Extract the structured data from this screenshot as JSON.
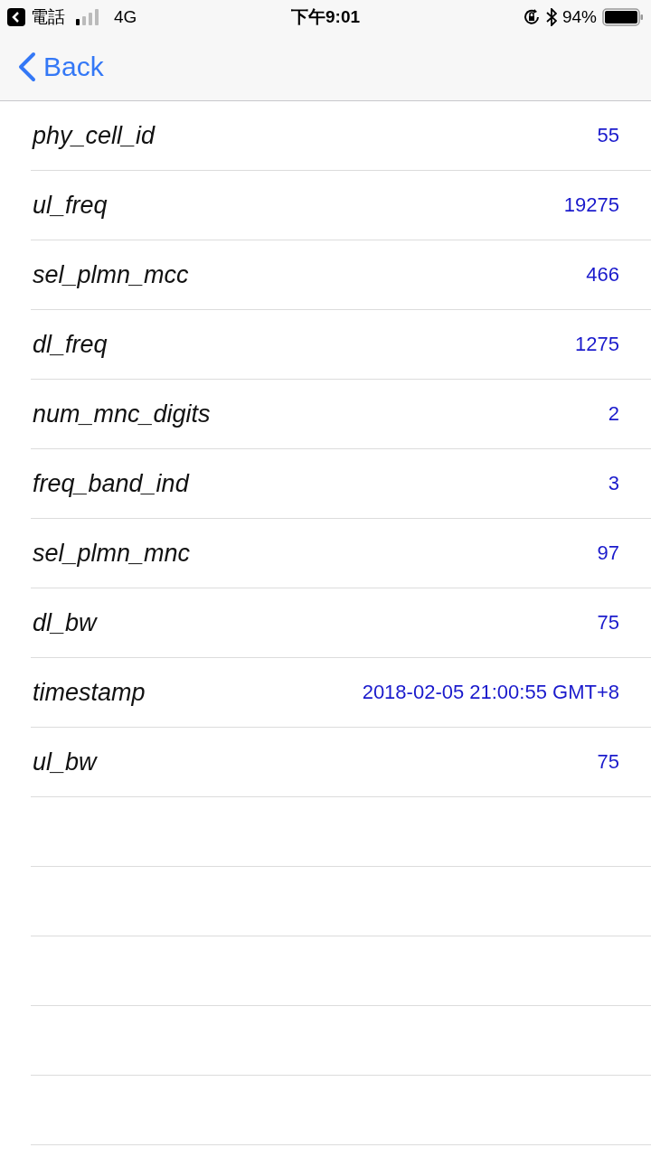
{
  "status_bar": {
    "back_app": "電話",
    "network": "4G",
    "time": "下午9:01",
    "battery": "94%"
  },
  "nav": {
    "back": "Back"
  },
  "rows": [
    {
      "key": "phy_cell_id",
      "value": "55"
    },
    {
      "key": "ul_freq",
      "value": "19275"
    },
    {
      "key": "sel_plmn_mcc",
      "value": "466"
    },
    {
      "key": "dl_freq",
      "value": "1275"
    },
    {
      "key": "num_mnc_digits",
      "value": "2"
    },
    {
      "key": "freq_band_ind",
      "value": "3"
    },
    {
      "key": "sel_plmn_mnc",
      "value": "97"
    },
    {
      "key": "dl_bw",
      "value": "75"
    },
    {
      "key": "timestamp",
      "value": "2018-02-05 21:00:55 GMT+8"
    },
    {
      "key": "ul_bw",
      "value": "75"
    }
  ]
}
